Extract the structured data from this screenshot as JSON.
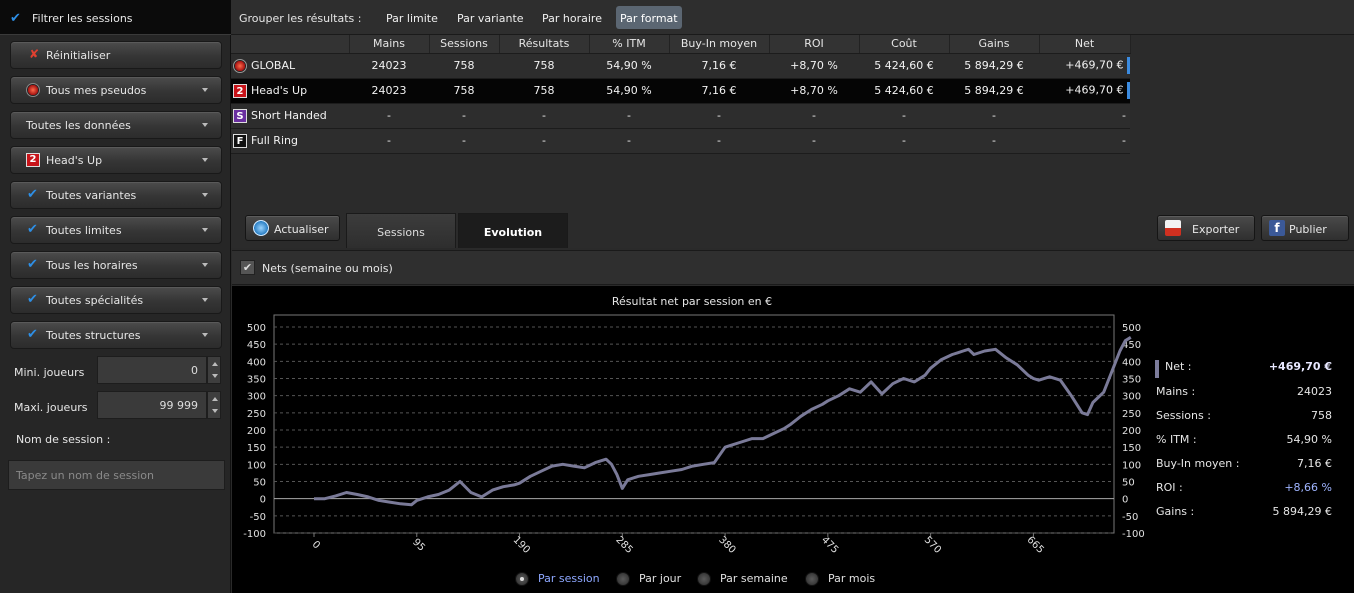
{
  "sidebar": {
    "filter_title": "Filtrer les sessions",
    "buttons": [
      {
        "label": "Réinitialiser",
        "icon": "close-x-icon"
      },
      {
        "label": "Tous mes pseudos",
        "icon": "poker-logo-icon"
      },
      {
        "label": "Toutes les données",
        "icon": ""
      },
      {
        "label": "Head's Up",
        "icon": "heads-up-2-icon",
        "icon_text": "2"
      },
      {
        "label": "Toutes variantes",
        "icon": "checkmark-icon"
      },
      {
        "label": "Toutes limites",
        "icon": "checkmark-icon"
      },
      {
        "label": "Tous les horaires",
        "icon": "checkmark-icon"
      },
      {
        "label": "Toutes spécialités",
        "icon": "checkmark-icon"
      },
      {
        "label": "Toutes structures",
        "icon": "checkmark-icon"
      }
    ],
    "min_players_label": "Mini. joueurs",
    "min_players_value": "0",
    "max_players_label": "Maxi. joueurs",
    "max_players_value": "99 999",
    "session_name_label": "Nom de session :",
    "session_name_placeholder": "Tapez un nom de session"
  },
  "groupbar": {
    "label": "Grouper les résultats :",
    "tabs": [
      "Par limite",
      "Par variante",
      "Par horaire",
      "Par format"
    ],
    "active": "Par format"
  },
  "table": {
    "columns": [
      "Mains",
      "Sessions",
      "Résultats",
      "% ITM",
      "Buy-In moyen",
      "ROI",
      "Coût",
      "Gains",
      "Net"
    ],
    "rows": [
      {
        "name": "GLOBAL",
        "icon": "poker-logo-icon",
        "values": [
          "24023",
          "758",
          "758",
          "54,90 %",
          "7,16 €",
          "+8,70 %",
          "5 424,60 €",
          "5 894,29 €",
          "+469,70 €"
        ]
      },
      {
        "name": "Head's Up",
        "icon": "heads-up-2-icon",
        "icon_text": "2",
        "values": [
          "24023",
          "758",
          "758",
          "54,90 %",
          "7,16 €",
          "+8,70 %",
          "5 424,60 €",
          "5 894,29 €",
          "+469,70 €"
        ]
      },
      {
        "name": "Short Handed",
        "icon": "short-handed-s-icon",
        "icon_text": "S",
        "values": [
          "-",
          "-",
          "-",
          "-",
          "-",
          "-",
          "-",
          "-",
          "-"
        ]
      },
      {
        "name": "Full Ring",
        "icon": "full-ring-f-icon",
        "icon_text": "F",
        "values": [
          "-",
          "-",
          "-",
          "-",
          "-",
          "-",
          "-",
          "-",
          "-"
        ]
      }
    ]
  },
  "toolbar": {
    "refresh_label": "Actualiser",
    "tab_sessions": "Sessions",
    "tab_evolution": "Evolution",
    "export_label": "Exporter",
    "publish_label": "Publier"
  },
  "nets_checkbox_label": "Nets (semaine ou mois)",
  "chart_data": {
    "type": "line",
    "title": "Résultat net par session en €",
    "ylim": [
      -100,
      500
    ],
    "yticks": [
      -100,
      -50,
      0,
      50,
      100,
      150,
      200,
      250,
      300,
      350,
      400,
      450,
      500
    ],
    "xticks": [
      0,
      95,
      190,
      285,
      380,
      475,
      570,
      665
    ],
    "xlim": [
      0,
      758
    ],
    "series": [
      {
        "color": "#7a7a98",
        "x": [
          0,
          10,
          20,
          30,
          40,
          50,
          60,
          70,
          80,
          90,
          95,
          105,
          115,
          125,
          135,
          145,
          155,
          165,
          175,
          185,
          190,
          200,
          210,
          220,
          230,
          240,
          250,
          260,
          270,
          275,
          280,
          285,
          290,
          300,
          310,
          320,
          330,
          340,
          350,
          360,
          370,
          380,
          385,
          395,
          405,
          415,
          425,
          435,
          440,
          450,
          460,
          470,
          475,
          485,
          495,
          505,
          515,
          525,
          535,
          545,
          555,
          565,
          570,
          580,
          590,
          595,
          600,
          605,
          610,
          620,
          630,
          640,
          650,
          660,
          665,
          670,
          680,
          690,
          700,
          710,
          715,
          720,
          730,
          740,
          745,
          750,
          755
        ],
        "y": [
          0,
          0,
          8,
          18,
          12,
          5,
          -5,
          -10,
          -15,
          -18,
          -5,
          5,
          12,
          25,
          50,
          18,
          5,
          25,
          35,
          40,
          45,
          65,
          80,
          95,
          100,
          95,
          90,
          105,
          115,
          100,
          70,
          30,
          55,
          65,
          70,
          75,
          80,
          85,
          95,
          100,
          105,
          150,
          155,
          165,
          175,
          175,
          190,
          205,
          215,
          240,
          260,
          275,
          285,
          300,
          320,
          310,
          340,
          305,
          335,
          350,
          340,
          360,
          380,
          405,
          420,
          425,
          430,
          435,
          420,
          430,
          435,
          410,
          390,
          360,
          350,
          345,
          355,
          345,
          300,
          250,
          245,
          280,
          310,
          390,
          430,
          460,
          470
        ]
      }
    ]
  },
  "stats": [
    {
      "k": "Net :",
      "v": "+469,70 €",
      "style": "bold"
    },
    {
      "k": "Mains :",
      "v": "24023",
      "style": ""
    },
    {
      "k": "Sessions :",
      "v": "758",
      "style": ""
    },
    {
      "k": "% ITM :",
      "v": "54,90 %",
      "style": ""
    },
    {
      "k": "Buy-In moyen :",
      "v": "7,16 €",
      "style": ""
    },
    {
      "k": "ROI :",
      "v": "+8,66 %",
      "style": "blue"
    },
    {
      "k": "Gains :",
      "v": "5 894,29 €",
      "style": ""
    }
  ],
  "radios": [
    {
      "label": "Par session",
      "selected": true
    },
    {
      "label": "Par jour",
      "selected": false
    },
    {
      "label": "Par semaine",
      "selected": false
    },
    {
      "label": "Par mois",
      "selected": false
    }
  ]
}
